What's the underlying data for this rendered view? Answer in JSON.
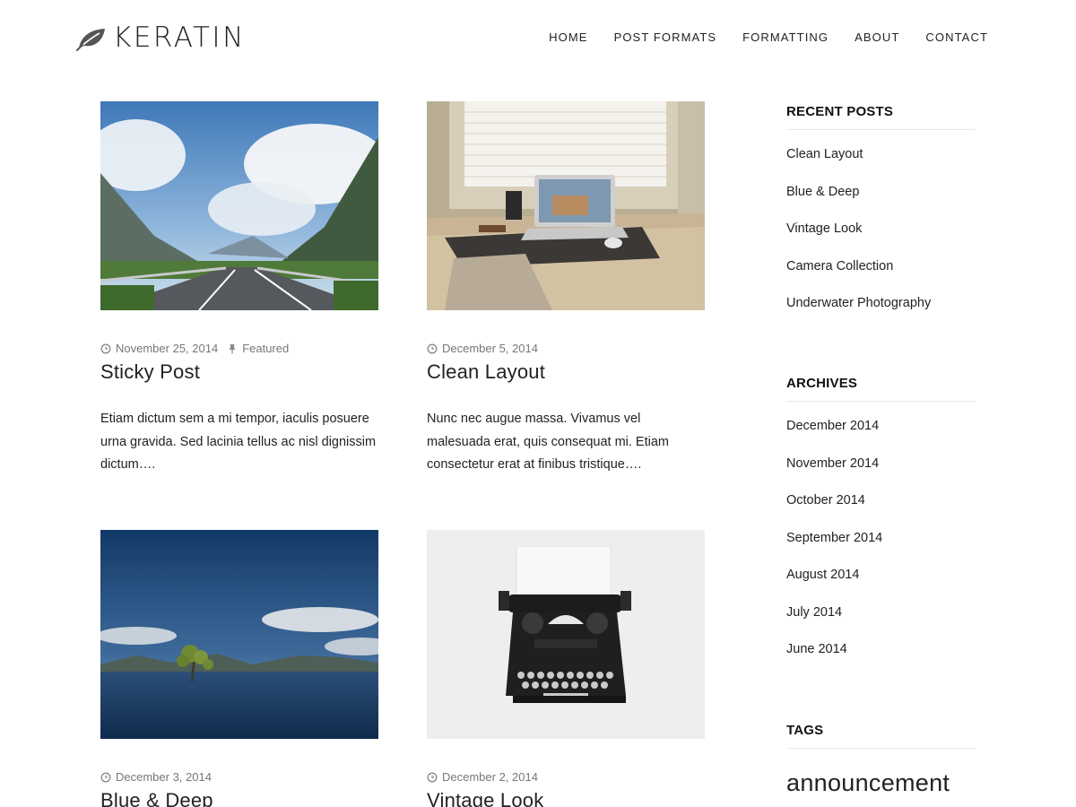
{
  "site": {
    "logo_text": "KERATIN"
  },
  "nav": [
    "HOME",
    "POST FORMATS",
    "FORMATTING",
    "ABOUT",
    "CONTACT"
  ],
  "posts": [
    {
      "date": "November 25, 2014",
      "tag": "Featured",
      "title": "Sticky Post",
      "excerpt": "Etiam dictum sem a mi tempor, iaculis posuere urna gravida. Sed lacinia tellus ac nisl dignissim dictum…."
    },
    {
      "date": "December 5, 2014",
      "title": "Clean Layout",
      "excerpt": "Nunc nec augue massa. Vivamus vel malesuada erat, quis consequat mi. Etiam consectetur erat at finibus tristique…."
    },
    {
      "date": "December 3, 2014",
      "title": "Blue & Deep"
    },
    {
      "date": "December 2, 2014",
      "title": "Vintage Look"
    }
  ],
  "sidebar": {
    "recent_title": "RECENT POSTS",
    "recent": [
      "Clean Layout",
      "Blue & Deep",
      "Vintage Look",
      "Camera Collection",
      "Underwater Photography"
    ],
    "archives_title": "ARCHIVES",
    "archives": [
      "December 2014",
      "November 2014",
      "October 2014",
      "September 2014",
      "August 2014",
      "July 2014",
      "June 2014"
    ],
    "tags_title": "TAGS",
    "tags": [
      "announcement"
    ]
  }
}
